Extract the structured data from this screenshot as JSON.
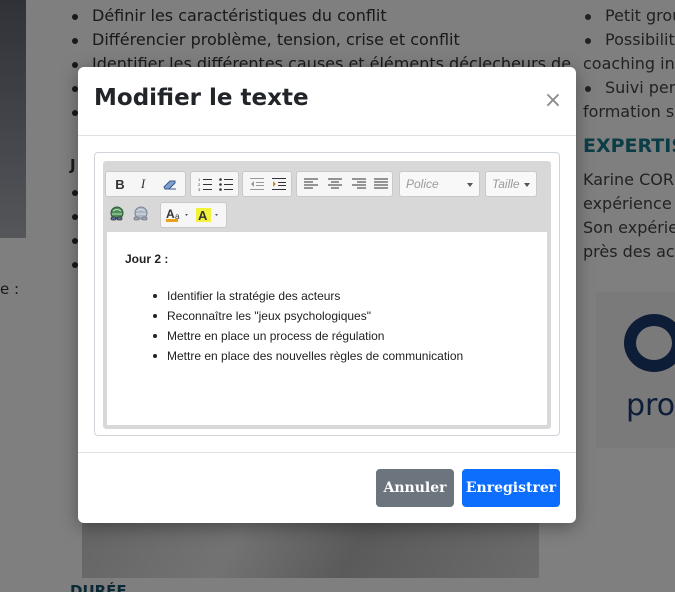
{
  "background": {
    "top_list": [
      "Définir les caractéristiques du conflit",
      "Différencier problème, tension, crise et conflit",
      "Identifier les différentes causes et éléments déclecheurs de",
      "",
      ""
    ],
    "day_letter": "J",
    "mid_list": [
      "",
      "",
      "",
      ""
    ],
    "side_text": "e :",
    "section_heading": "DURÉE",
    "right_bullets": [
      "Petit grou",
      "Possibilite"
    ],
    "right_lines_1": [
      "coaching ind"
    ],
    "right_bullets_2": [
      "Suivi pers"
    ],
    "right_lines_2": [
      "formation su"
    ],
    "right_heading": "EXPERTISE",
    "right_paragraph": [
      "Karine CORB",
      "expérience e",
      "Son expérien",
      "près des acte"
    ],
    "logo_text": "pro"
  },
  "modal": {
    "title": "Modifier le texte",
    "close_label": "×",
    "toolbar": {
      "font_placeholder": "Police",
      "size_placeholder": "Taille"
    },
    "content": {
      "heading": "Jour 2 :",
      "items": [
        "Identifier la stratégie des acteurs",
        "Reconnaître les \"jeux psychologiques\"",
        "Mettre en place un process de régulation",
        "Mettre en place des nouvelles règles de communication"
      ]
    },
    "cancel_label": "Annuler",
    "save_label": "Enregistrer"
  },
  "colors": {
    "primary": "#0d6efd",
    "secondary": "#6c757d",
    "expertise_heading": "#167a8c",
    "logo": "#1b3a6e"
  }
}
